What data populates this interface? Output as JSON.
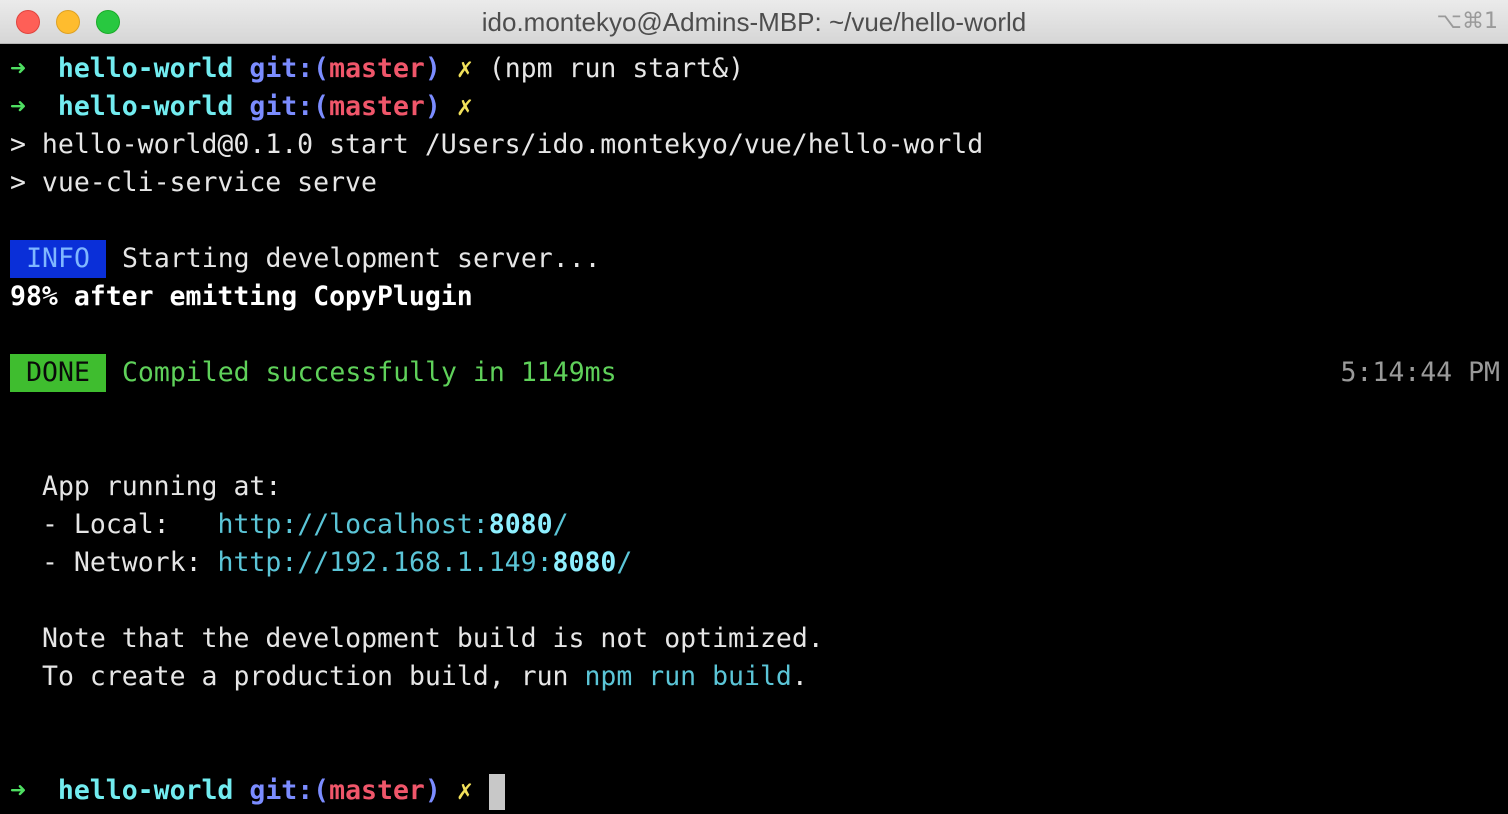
{
  "window": {
    "title": "ido.montekyo@Admins-MBP: ~/vue/hello-world",
    "shortcut": "⌥⌘1"
  },
  "prompt": {
    "arrow": "➜",
    "dir": "hello-world",
    "git_prefix": "git:(",
    "branch": "master",
    "git_suffix": ")",
    "dirty": "✗"
  },
  "lines": {
    "cmd1": "(npm run start&)",
    "npm_start": "> hello-world@0.1.0 start /Users/ido.montekyo/vue/hello-world",
    "npm_serve": "> vue-cli-service serve",
    "info_badge": "INFO",
    "info_text": "Starting development server...",
    "progress": "98% after emitting CopyPlugin",
    "done_badge": "DONE",
    "done_text": "Compiled successfully in 1149ms",
    "done_time": "5:14:44 PM",
    "app_running": "App running at:",
    "local_label": "- Local:   ",
    "local_url_base": "http://localhost:",
    "local_port": "8080",
    "local_slash": "/",
    "network_label": "- Network: ",
    "network_url_base": "http://192.168.1.149:",
    "network_port": "8080",
    "network_slash": "/",
    "note1": "Note that the development build is not optimized.",
    "note2_prefix": "To create a production build, run ",
    "note2_cmd": "npm run build",
    "note2_suffix": "."
  }
}
